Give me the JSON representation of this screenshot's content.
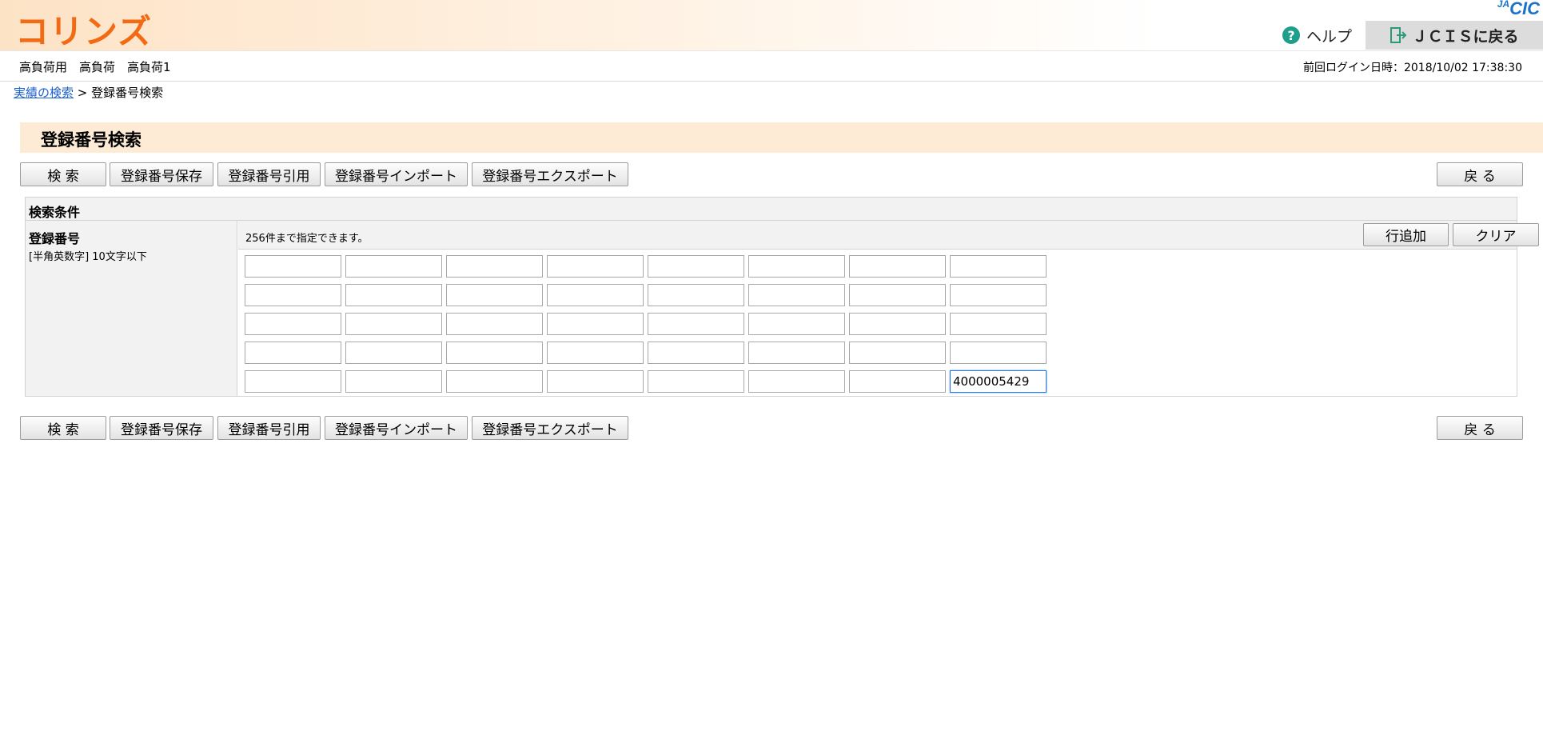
{
  "header": {
    "logo": "コリンズ",
    "brand_prefix": "JA",
    "brand": "CIC",
    "help_label": "ヘルプ",
    "back_label": "ＪＣＩＳに戻る"
  },
  "user": {
    "name": "高負荷用　高負荷　高負荷1",
    "last_login": "前回ログイン日時：2018/10/02 17:38:30"
  },
  "breadcrumb": {
    "link": "実績の検索",
    "separator": ">",
    "current": "登録番号検索"
  },
  "page_title": "登録番号検索",
  "toolbar": {
    "search": "検 索",
    "save": "登録番号保存",
    "cite": "登録番号引用",
    "import": "登録番号インポート",
    "export": "登録番号エクスポート",
    "back": "戻 る"
  },
  "panel": {
    "header": "検索条件",
    "field_label": "登録番号",
    "field_hint": "[半角英数字] 10文字以下",
    "info": "256件まで指定できます。",
    "add_row": "行追加",
    "clear": "クリア"
  },
  "reg_numbers": [
    [
      "",
      "",
      "",
      "",
      "",
      "",
      "",
      ""
    ],
    [
      "",
      "",
      "",
      "",
      "",
      "",
      "",
      ""
    ],
    [
      "",
      "",
      "",
      "",
      "",
      "",
      "",
      ""
    ],
    [
      "",
      "",
      "",
      "",
      "",
      "",
      "",
      ""
    ],
    [
      "",
      "",
      "",
      "",
      "",
      "",
      "",
      "4000005429"
    ]
  ],
  "colors": {
    "logo": "#f26b14",
    "brand": "#1a73c8",
    "title_bar": "#fdebd6",
    "help_icon": "#1f9e8c"
  }
}
